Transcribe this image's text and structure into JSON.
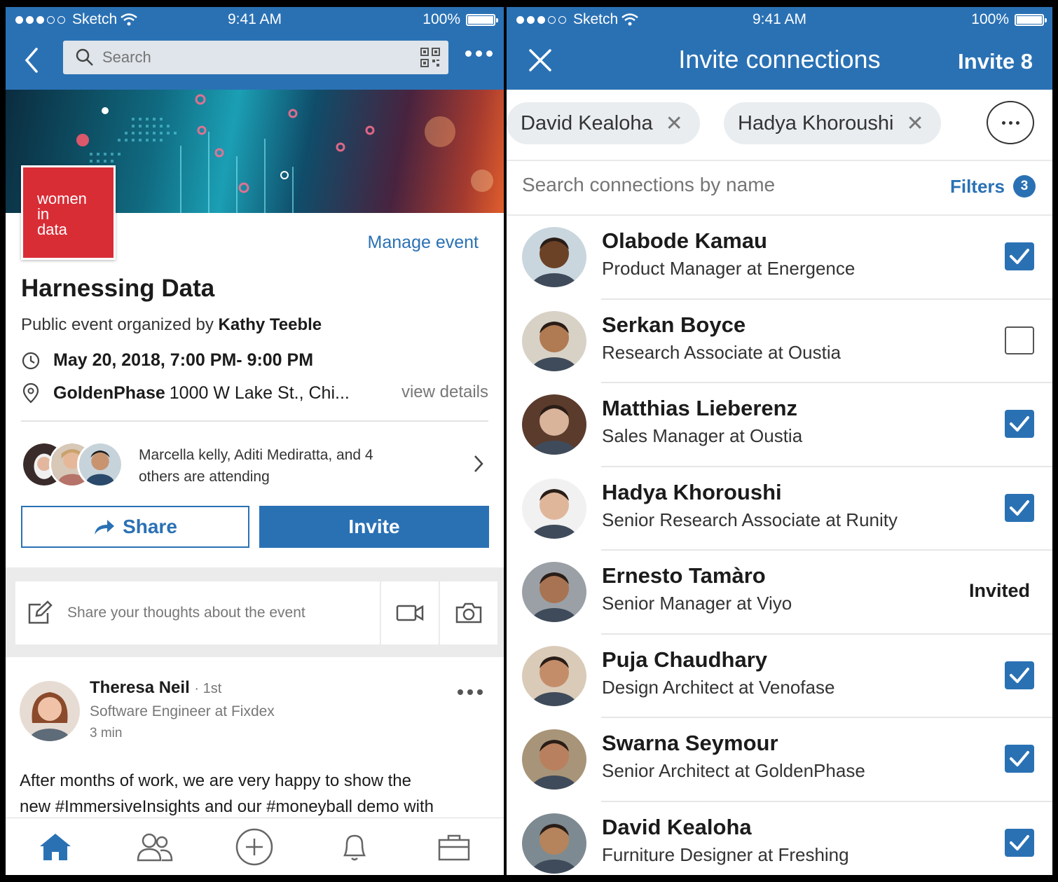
{
  "status": {
    "carrier": "Sketch",
    "time": "9:41 AM",
    "battery": "100%"
  },
  "left": {
    "search_placeholder": "Search",
    "logo": {
      "line1": "women",
      "line2": "in",
      "line3": "data"
    },
    "manage_event": "Manage event",
    "title": "Harnessing Data",
    "organizer_prefix": "Public event organized by",
    "organizer": "Kathy Teeble",
    "date": "May 20, 2018, 7:00 PM- 9:00 PM",
    "location_name": "GoldenPhase",
    "location_address": "1000 W Lake St., Chi...",
    "view_details": "view details",
    "attending_line1": "Marcella kelly, Aditi Mediratta, and 4",
    "attending_line2": "others are attending",
    "share_label": "Share",
    "invite_label": "Invite",
    "share_placeholder": "Share your thoughts about the event",
    "post": {
      "author": "Theresa Neil",
      "degree": "· 1st",
      "headline": "Software Engineer at Fixdex",
      "time": "3 min",
      "body_line1": "After months of work, we are very happy to show the",
      "body_line2": "new #ImmersiveInsights and our #moneyball demo with"
    },
    "tabs": [
      "home-icon",
      "network-icon",
      "post-icon",
      "notifications-icon",
      "jobs-icon"
    ]
  },
  "right": {
    "title": "Invite connections",
    "invite_count": "Invite 8",
    "chips": [
      "David Kealoha",
      "Hadya Khoroushi"
    ],
    "search_placeholder": "Search connections by name",
    "filters_label": "Filters",
    "filters_count": "3",
    "invited_label": "Invited",
    "connections": [
      {
        "name": "Olabode Kamau",
        "title": "Product Manager at Energence",
        "state": "checked",
        "skin": "#6b4226",
        "bg": "#c9d6de"
      },
      {
        "name": "Serkan Boyce",
        "title": "Research Associate at Oustia",
        "state": "unchecked",
        "skin": "#b07a52",
        "bg": "#d8d2c6"
      },
      {
        "name": "Matthias Lieberenz",
        "title": "Sales Manager at Oustia",
        "state": "checked",
        "skin": "#d9b39a",
        "bg": "#5a3b2c"
      },
      {
        "name": "Hadya Khoroushi",
        "title": "Senior Research Associate at Runity",
        "state": "checked",
        "skin": "#e0b69b",
        "bg": "#f1f1f1"
      },
      {
        "name": "Ernesto Tamàro",
        "title": "Senior Manager at Viyo",
        "state": "invited",
        "skin": "#a87352",
        "bg": "#9aa0a6"
      },
      {
        "name": "Puja Chaudhary",
        "title": "Design Architect at Venofase",
        "state": "checked",
        "skin": "#c48d6a",
        "bg": "#d9cbb8"
      },
      {
        "name": "Swarna Seymour",
        "title": "Senior Architect at GoldenPhase",
        "state": "checked",
        "skin": "#b8805e",
        "bg": "#a89478"
      },
      {
        "name": "David Kealoha",
        "title": "Furniture Designer at Freshing",
        "state": "checked",
        "skin": "#b5845c",
        "bg": "#7d8a91"
      }
    ]
  }
}
